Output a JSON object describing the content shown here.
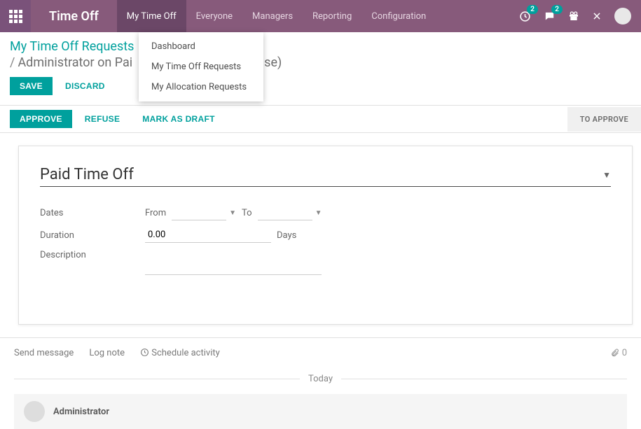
{
  "topbar": {
    "app_title": "Time Off",
    "nav": [
      "My Time Off",
      "Everyone",
      "Managers",
      "Reporting",
      "Configuration"
    ],
    "active_nav_index": 0,
    "badge1": "2",
    "badge2": "2"
  },
  "dropdown": {
    "items": [
      "Dashboard",
      "My Time Off Requests",
      "My Allocation Requests"
    ]
  },
  "breadcrumb": {
    "root": "My Time Off Requests",
    "current_visible": "Administrator on Pai",
    "current_suffix": "(False)"
  },
  "buttons": {
    "save": "SAVE",
    "discard": "DISCARD"
  },
  "status": {
    "approve": "APPROVE",
    "refuse": "REFUSE",
    "mark_draft": "MARK AS DRAFT",
    "to_approve": "TO APPROVE"
  },
  "form": {
    "type_value": "Paid Time Off",
    "labels": {
      "dates": "Dates",
      "from": "From",
      "to": "To",
      "duration": "Duration",
      "days": "Days",
      "description": "Description"
    },
    "duration_value": "0.00"
  },
  "chatter": {
    "send": "Send message",
    "log": "Log note",
    "schedule": "Schedule activity",
    "attach_count": "0",
    "today": "Today",
    "author": "Administrator"
  }
}
